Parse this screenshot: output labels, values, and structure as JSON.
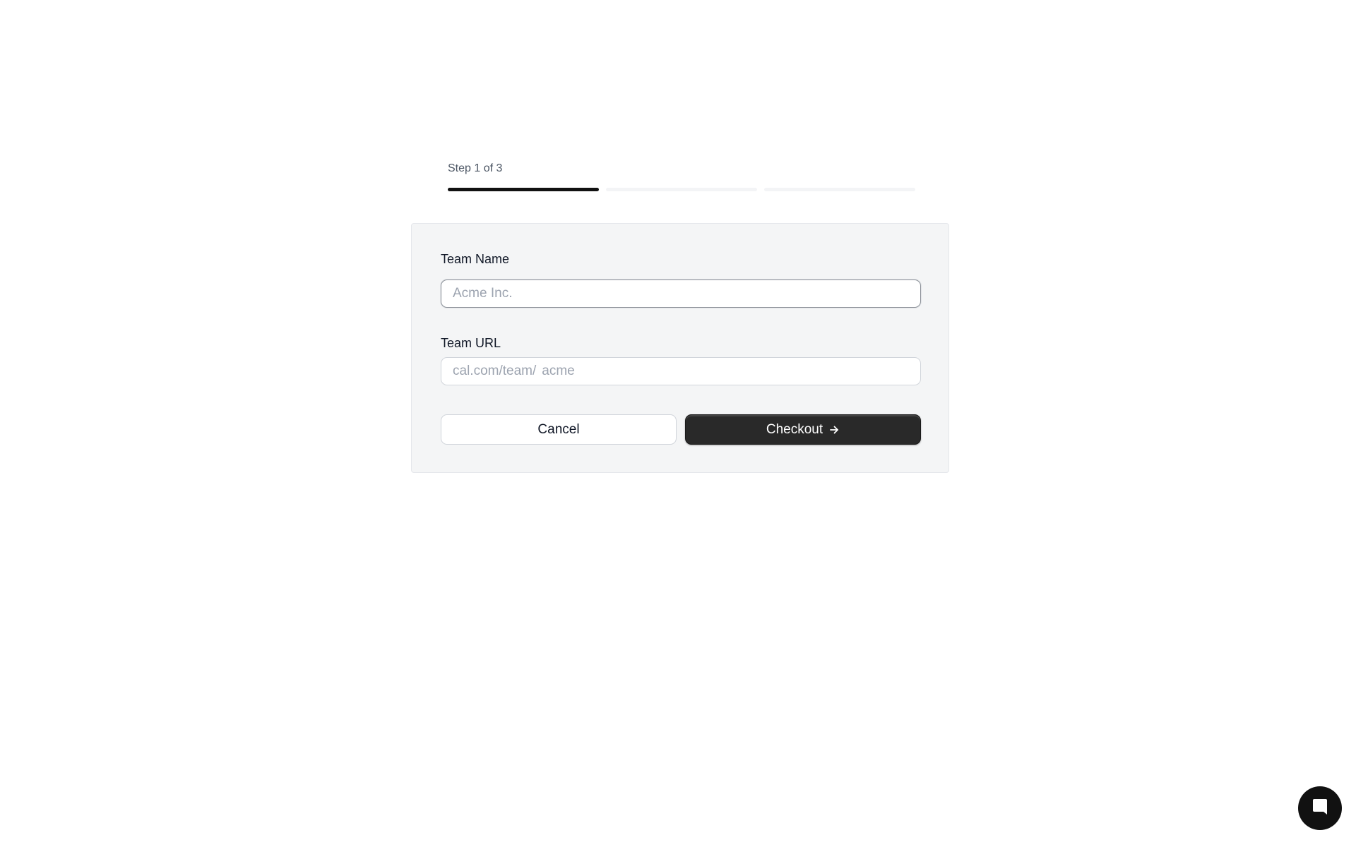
{
  "stepper": {
    "label": "Step 1 of 3",
    "current_step": 1,
    "total_steps": 3
  },
  "form": {
    "team_name": {
      "label": "Team Name",
      "placeholder": "Acme Inc.",
      "value": ""
    },
    "team_url": {
      "label": "Team URL",
      "prefix": "cal.com/team/",
      "placeholder": "acme",
      "value": ""
    },
    "cancel_label": "Cancel",
    "checkout_label": "Checkout"
  },
  "icons": {
    "checkout_arrow": "arrow-right-icon",
    "chat": "chat-bubble-icon"
  },
  "colors": {
    "primary_button": "#292929",
    "progress_active": "#111111",
    "progress_inactive": "#f3f4f6",
    "card_background": "#f4f5f6"
  }
}
